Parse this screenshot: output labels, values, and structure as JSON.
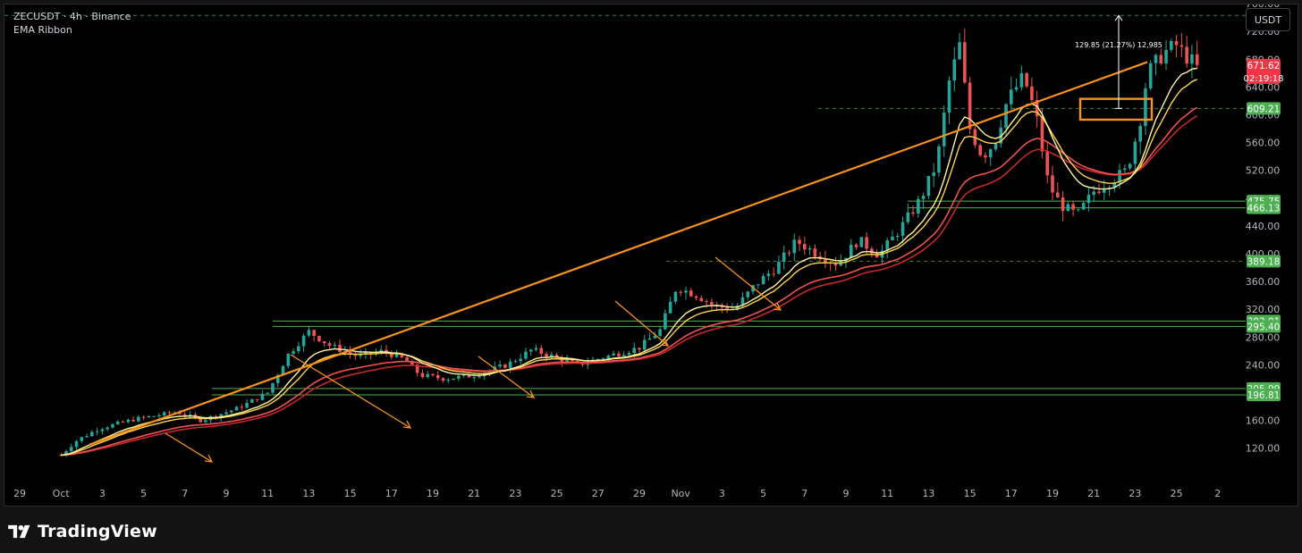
{
  "legend": {
    "symbol_line": "ZECUSDT · 4h · Binance",
    "indicator": "EMA Ribbon"
  },
  "currency_button": "USDT",
  "brand": {
    "name": "TradingView"
  },
  "measure_label": "129.85 (21.27%) 12,985",
  "countdown": "02:19:18",
  "colors": {
    "background": "#000000",
    "frame": "#131313",
    "up": "#26a69a",
    "down": "#ef5350",
    "trendline": "#f7931a",
    "level_line": "#4caf50",
    "dashed_level": "#4a7a4a",
    "price_label_green": "#4caf50",
    "price_label_red": "#f23645",
    "ema_fast_a": "#fff59d",
    "ema_fast_b": "#ffd54f",
    "ema_slow_a": "#ef5350",
    "ema_slow_b": "#c62828"
  },
  "chart_data": {
    "type": "candlestick",
    "symbol": "ZECUSDT",
    "timeframe": "4h",
    "exchange": "Binance",
    "ylim": [
      95,
      775
    ],
    "y_ticks": [
      "120.00",
      "160.00",
      "200.00",
      "240.00",
      "280.00",
      "320.00",
      "360.00",
      "400.00",
      "440.00",
      "480.00",
      "520.00",
      "560.00",
      "600.00",
      "640.00",
      "680.00",
      "720.00",
      "760.00"
    ],
    "x_ticks": [
      "29",
      "Oct",
      "3",
      "5",
      "7",
      "9",
      "11",
      "13",
      "15",
      "17",
      "19",
      "21",
      "23",
      "25",
      "27",
      "29",
      "Nov",
      "3",
      "5",
      "7",
      "9",
      "11",
      "13",
      "15",
      "17",
      "19",
      "21",
      "23",
      "25",
      "2"
    ],
    "price_levels": [
      {
        "value": "743.13",
        "style": "dashed"
      },
      {
        "value": "671.62",
        "style": "current"
      },
      {
        "value": "609.21",
        "style": "dashed"
      },
      {
        "value": "475.75",
        "style": "solid"
      },
      {
        "value": "466.13",
        "style": "solid"
      },
      {
        "value": "389.18",
        "style": "dashed"
      },
      {
        "value": "303.01",
        "style": "solid"
      },
      {
        "value": "295.40",
        "style": "solid"
      },
      {
        "value": "205.99",
        "style": "solid"
      },
      {
        "value": "196.81",
        "style": "solid"
      }
    ],
    "trendline": [
      {
        "date": "Oct 3",
        "price": 125
      },
      {
        "date": "Nov 22",
        "price": 676
      }
    ],
    "target_box": {
      "price_low": 593,
      "price_high": 623
    },
    "price_path": [
      {
        "x": 0.0,
        "p": 110
      },
      {
        "x": 0.35,
        "p": 130
      },
      {
        "x": 0.9,
        "p": 148
      },
      {
        "x": 1.8,
        "p": 162
      },
      {
        "x": 2.8,
        "p": 172
      },
      {
        "x": 3.4,
        "p": 160
      },
      {
        "x": 4.3,
        "p": 178
      },
      {
        "x": 5.0,
        "p": 200
      },
      {
        "x": 5.5,
        "p": 255
      },
      {
        "x": 6.0,
        "p": 288
      },
      {
        "x": 6.5,
        "p": 268
      },
      {
        "x": 7.2,
        "p": 252
      },
      {
        "x": 7.8,
        "p": 260
      },
      {
        "x": 8.3,
        "p": 248
      },
      {
        "x": 8.7,
        "p": 225
      },
      {
        "x": 9.3,
        "p": 220
      },
      {
        "x": 10.0,
        "p": 225
      },
      {
        "x": 10.8,
        "p": 240
      },
      {
        "x": 11.4,
        "p": 262
      },
      {
        "x": 12.0,
        "p": 250
      },
      {
        "x": 12.5,
        "p": 240
      },
      {
        "x": 13.2,
        "p": 252
      },
      {
        "x": 14.0,
        "p": 265
      },
      {
        "x": 14.5,
        "p": 290
      },
      {
        "x": 14.9,
        "p": 352
      },
      {
        "x": 15.4,
        "p": 340
      },
      {
        "x": 15.8,
        "p": 325
      },
      {
        "x": 16.3,
        "p": 320
      },
      {
        "x": 16.8,
        "p": 355
      },
      {
        "x": 17.3,
        "p": 380
      },
      {
        "x": 17.8,
        "p": 418
      },
      {
        "x": 18.3,
        "p": 400
      },
      {
        "x": 18.8,
        "p": 385
      },
      {
        "x": 19.3,
        "p": 420
      },
      {
        "x": 19.8,
        "p": 398
      },
      {
        "x": 20.3,
        "p": 435
      },
      {
        "x": 20.8,
        "p": 478
      },
      {
        "x": 21.2,
        "p": 530
      },
      {
        "x": 21.5,
        "p": 648
      },
      {
        "x": 21.75,
        "p": 700
      },
      {
        "x": 22.0,
        "p": 580
      },
      {
        "x": 22.3,
        "p": 540
      },
      {
        "x": 22.6,
        "p": 560
      },
      {
        "x": 22.9,
        "p": 620
      },
      {
        "x": 23.3,
        "p": 655
      },
      {
        "x": 23.6,
        "p": 600
      },
      {
        "x": 23.9,
        "p": 500
      },
      {
        "x": 24.2,
        "p": 470
      },
      {
        "x": 24.6,
        "p": 455
      },
      {
        "x": 25.0,
        "p": 490
      },
      {
        "x": 25.4,
        "p": 505
      },
      {
        "x": 25.8,
        "p": 520
      },
      {
        "x": 26.1,
        "p": 585
      },
      {
        "x": 26.3,
        "p": 660
      },
      {
        "x": 26.7,
        "p": 690
      },
      {
        "x": 27.0,
        "p": 700
      },
      {
        "x": 27.3,
        "p": 680
      },
      {
        "x": 27.5,
        "p": 671.62
      }
    ]
  }
}
